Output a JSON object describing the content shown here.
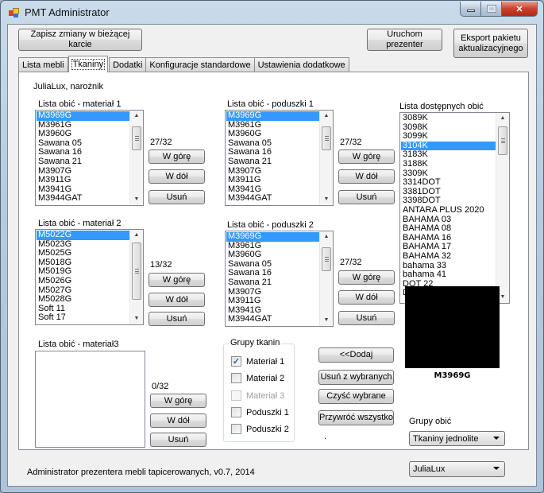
{
  "window": {
    "title": "PMT Administrator",
    "controls": {
      "minimize": "minimize",
      "maximize": "maximize",
      "close": "close"
    }
  },
  "toolbar": {
    "save_label": "Zapisz zmiany w bieżącej karcie",
    "launch_label": "Uruchom prezenter",
    "export_label": "Eksport pakietu aktualizacyjnego"
  },
  "tabs": [
    {
      "label": "Lista mebli",
      "active": false
    },
    {
      "label": "Tkaniny",
      "active": true
    },
    {
      "label": "Dodatki",
      "active": false
    },
    {
      "label": "Konfiguracje standardowe",
      "active": false
    },
    {
      "label": "Ustawienia dodatkowe",
      "active": false
    }
  ],
  "panel": {
    "furniture_name": "JuliaLux, narożnik",
    "lists": {
      "material1": {
        "label": "Lista obić - materiał 1",
        "count": "27/32",
        "selected": "M3969G",
        "items": [
          "M3969G",
          "M3961G",
          "M3960G",
          "Sawana 05",
          "Sawana 16",
          "Sawana 21",
          "M3907G",
          "M3911G",
          "M3941G",
          "M3944GAT"
        ]
      },
      "cushions1": {
        "label": "Lista obić - poduszki 1",
        "count": "27/32",
        "selected": "M3969G",
        "items": [
          "M3969G",
          "M3961G",
          "M3960G",
          "Sawana 05",
          "Sawana 16",
          "Sawana 21",
          "M3907G",
          "M3911G",
          "M3941G",
          "M3944GAT"
        ]
      },
      "material2": {
        "label": "Lista obić - materiał 2",
        "count": "13/32",
        "selected": "M5022G",
        "items": [
          "M5022G",
          "M5023G",
          "M5025G",
          "M5018G",
          "M5019G",
          "M5026G",
          "M5027G",
          "M5028G",
          "Soft 11",
          "Soft 17"
        ]
      },
      "cushions2": {
        "label": "Lista obić - poduszki 2",
        "count": "27/32",
        "selected": "M3969G",
        "items": [
          "M3969G",
          "M3961G",
          "M3960G",
          "Sawana 05",
          "Sawana 16",
          "Sawana 21",
          "M3907G",
          "M3911G",
          "M3941G",
          "M3944GAT"
        ]
      },
      "material3": {
        "label": "Lista obić - materiał3",
        "count": "0/32",
        "selected": null,
        "items": []
      },
      "available": {
        "label": "Lista dostępnych obić",
        "selected": "3104K",
        "items": [
          "3089K",
          "3098K",
          "3099K",
          "3104K",
          "3183K",
          "3188K",
          "3309K",
          "3314DOT",
          "3381DOT",
          "3398DOT",
          "ANTARA PLUS 2020",
          "BAHAMA 03",
          "BAHAMA 08",
          "BAHAMA 16",
          "BAHAMA 17",
          "BAHAMA 32",
          "bahama 33",
          "bahama 41",
          "DOT 22",
          "DOT 90"
        ]
      }
    },
    "buttons": {
      "up": "W górę",
      "down": "W dół",
      "remove": "Usuń",
      "add": "<<Dodaj",
      "remove_selected": "Usuń z wybranych",
      "clear_selected": "Czyść wybrane",
      "restore_all": "Przywróć wszystko"
    },
    "fabric_groups": {
      "title": "Grupy tkanin",
      "items": [
        {
          "label": "Materiał 1",
          "checked": true,
          "enabled": true
        },
        {
          "label": "Materiał 2",
          "checked": false,
          "enabled": true
        },
        {
          "label": "Materiał 3",
          "checked": false,
          "enabled": false
        },
        {
          "label": "Poduszki 1",
          "checked": false,
          "enabled": true
        },
        {
          "label": "Poduszki 2",
          "checked": false,
          "enabled": true
        }
      ]
    },
    "preview": {
      "name": "M3969G",
      "color": "#000000"
    },
    "cover_groups": {
      "label": "Grupy obić",
      "selected": "Tkaniny jednolite"
    },
    "dot": "."
  },
  "footer": {
    "status": "Administrator prezentera mebli tapicerowanych, v0.7, 2014",
    "furniture_select": "JuliaLux"
  }
}
